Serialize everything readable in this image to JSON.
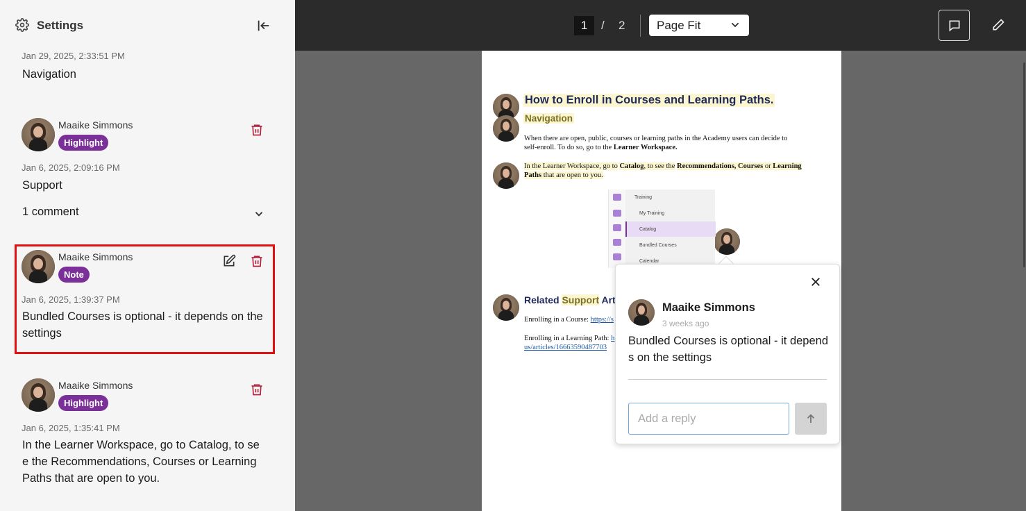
{
  "sidebar": {
    "title": "Settings",
    "top_item": {
      "timestamp": "Jan 29, 2025, 2:33:51 PM",
      "text": "Navigation"
    },
    "annotations": [
      {
        "author": "Maaike Simmons",
        "type": "Highlight",
        "timestamp": "Jan 6, 2025, 2:09:16 PM",
        "text": "Support",
        "comments": "1 comment"
      },
      {
        "author": "Maaike Simmons",
        "type": "Note",
        "timestamp": "Jan 6, 2025, 1:39:37 PM",
        "text_line1": "Bundled Courses is optional - it depends on the",
        "text_line2": "settings"
      },
      {
        "author": "Maaike Simmons",
        "type": "Highlight",
        "timestamp": "Jan 6, 2025, 1:35:41 PM",
        "text_line1": "In the Learner Workspace, go to Catalog, to se",
        "text_line2": "e the Recommendations, Courses or Learning",
        "text_line3": "Paths that are open to you."
      }
    ]
  },
  "toolbar": {
    "current_page": "1",
    "separator": "/",
    "total_pages": "2",
    "zoom": "Page Fit"
  },
  "document": {
    "title": "How to Enroll in Courses and Learning Paths.",
    "subtitle": "Navigation",
    "para1_a": "When there are open, public, courses or learning paths in the Academy users can decide to",
    "para1_b": "self-enroll. To do so, go to the",
    "para1_bold": "Learner Workspace.",
    "para2_a": "In the Learner Workspace, go to",
    "para2_catalog": "Catalog",
    "para2_b": ", to see the",
    "para2_rec": "Recommendations, Courses",
    "para2_or": " or ",
    "para2_lp": "Learning",
    "para2_paths": "Paths",
    "para2_c": " that are open to you.",
    "screenshot_items": [
      "Training",
      "My Training",
      "Catalog",
      "Bundled Courses",
      "Calendar"
    ],
    "related_a": "Related ",
    "related_hl": "Support",
    "related_b": " Arti",
    "link1_label": "Enrolling in a Course: ",
    "link1_url": "https://s",
    "link2_label": "Enrolling in a Learning Path: ",
    "link2_url": "h",
    "link2_cont": "us/articles/16663590487703"
  },
  "popup": {
    "author": "Maaike Simmons",
    "time": "3 weeks ago",
    "text": "Bundled Courses is optional - it depends on the settings",
    "reply_placeholder": "Add a reply"
  },
  "colors": {
    "badge": "#7b3099",
    "selection_border": "#e01010",
    "trash": "#b5223c",
    "highlight": "#fbf6cf"
  }
}
